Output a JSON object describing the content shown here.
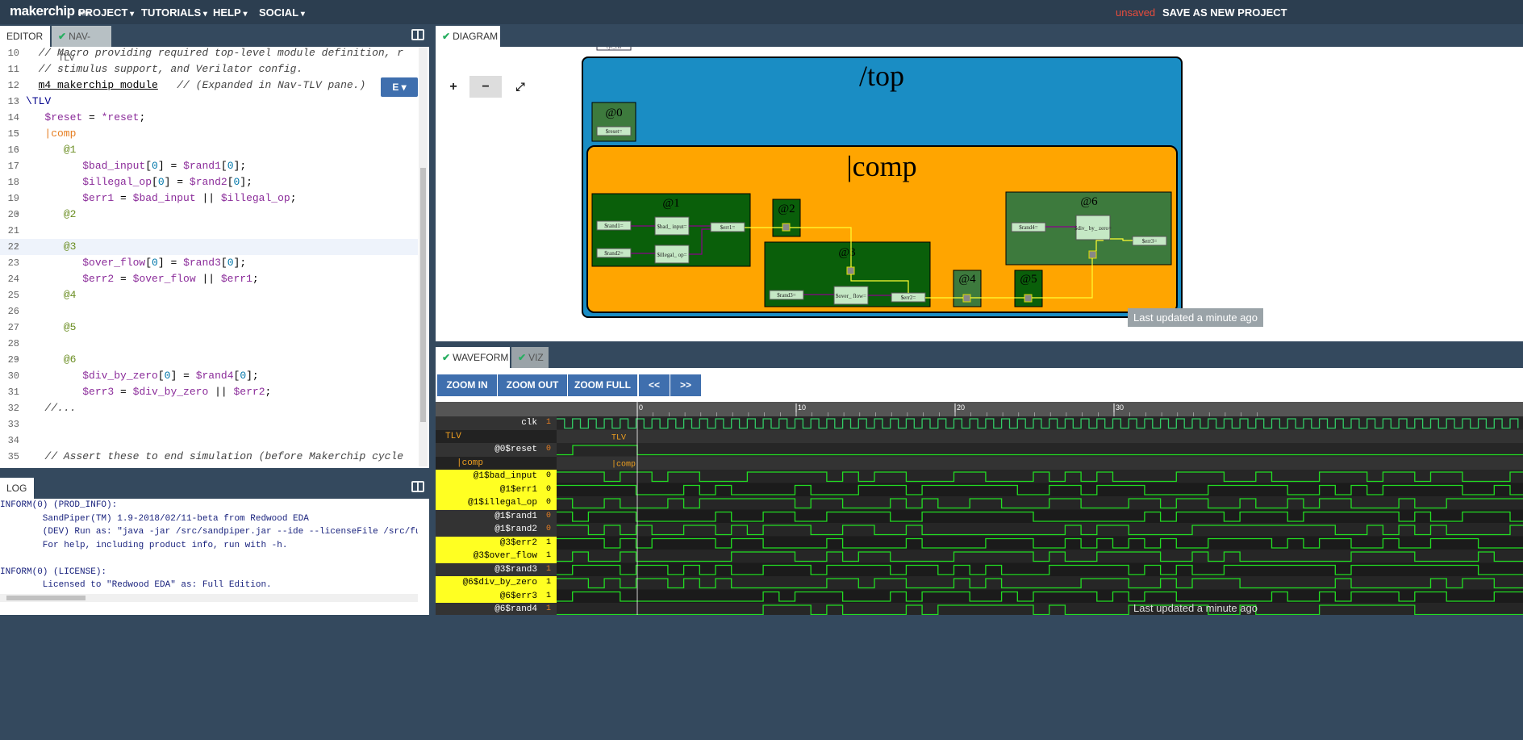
{
  "topbar": {
    "logo": "makerchip",
    "beta": "beta",
    "menus": [
      "PROJECT",
      "TUTORIALS",
      "HELP",
      "SOCIAL"
    ],
    "unsaved": "unsaved",
    "save": "SAVE AS NEW PROJECT"
  },
  "editor": {
    "tabs": [
      "EDITOR",
      "NAV-TLV"
    ],
    "e_button": "E ▾",
    "lines": [
      {
        "n": "10",
        "fold": "",
        "html": "<span class='cm'>  // Macro providing required top-level module definition, r</span>"
      },
      {
        "n": "11",
        "fold": "",
        "html": "<span class='cm'>  // stimulus support, and Verilator config.</span>"
      },
      {
        "n": "12",
        "fold": "",
        "html": "  <u>m4_makerchip_module</u>   <span class='cm'>// (Expanded in Nav-TLV pane.)</span>"
      },
      {
        "n": "13",
        "fold": "▾",
        "html": "<span class='kw'>\\TLV</span>"
      },
      {
        "n": "14",
        "fold": "",
        "html": "   <span class='var'>$reset</span> = <span class='var'>*reset</span>;"
      },
      {
        "n": "15",
        "fold": "▾",
        "html": "   <span class='pipe'>|comp</span>"
      },
      {
        "n": "16",
        "fold": "▾",
        "html": "      <span class='stg'>@1</span>"
      },
      {
        "n": "17",
        "fold": "",
        "html": "         <span class='var'>$bad_input</span>[<span class='num'>0</span>] = <span class='var'>$rand1</span>[<span class='num'>0</span>];"
      },
      {
        "n": "18",
        "fold": "",
        "html": "         <span class='var'>$illegal_op</span>[<span class='num'>0</span>] = <span class='var'>$rand2</span>[<span class='num'>0</span>];"
      },
      {
        "n": "19",
        "fold": "",
        "html": "         <span class='var'>$err1</span> = <span class='var'>$bad_input</span> || <span class='var'>$illegal_op</span>;"
      },
      {
        "n": "20",
        "fold": "▾",
        "html": "      <span class='stg'>@2</span>"
      },
      {
        "n": "21",
        "fold": "",
        "html": ""
      },
      {
        "n": "22",
        "fold": "▾",
        "html": "      <span class='stg'>@3</span>"
      },
      {
        "n": "23",
        "fold": "",
        "html": "         <span class='var'>$over_flow</span>[<span class='num'>0</span>] = <span class='var'>$rand3</span>[<span class='num'>0</span>];"
      },
      {
        "n": "24",
        "fold": "",
        "html": "         <span class='var'>$err2</span> = <span class='var'>$over_flow</span> || <span class='var'>$err1</span>;"
      },
      {
        "n": "25",
        "fold": "",
        "html": "      <span class='stg'>@4</span>"
      },
      {
        "n": "26",
        "fold": "",
        "html": ""
      },
      {
        "n": "27",
        "fold": "",
        "html": "      <span class='stg'>@5</span>"
      },
      {
        "n": "28",
        "fold": "",
        "html": ""
      },
      {
        "n": "29",
        "fold": "▾",
        "html": "      <span class='stg'>@6</span>"
      },
      {
        "n": "30",
        "fold": "",
        "html": "         <span class='var'>$div_by_zero</span>[<span class='num'>0</span>] = <span class='var'>$rand4</span>[<span class='num'>0</span>];"
      },
      {
        "n": "31",
        "fold": "",
        "html": "         <span class='var'>$err3</span> = <span class='var'>$div_by_zero</span> || <span class='var'>$err2</span>;"
      },
      {
        "n": "32",
        "fold": "",
        "html": "   <span class='cm'>//...</span>"
      },
      {
        "n": "33",
        "fold": "",
        "html": ""
      },
      {
        "n": "34",
        "fold": "",
        "html": ""
      },
      {
        "n": "35",
        "fold": "",
        "html": "<span class='cm'>   // Assert these to end simulation (before Makerchip cycle</span>"
      }
    ]
  },
  "log": {
    "tab": "LOG",
    "text": "INFORM(0) (PROD_INFO):\n        SandPiper(TM) 1.9-2018/02/11-beta from Redwood EDA\n        (DEV) Run as: \"java -jar /src/sandpiper.jar --ide --licenseFile /src/full_li\n        For help, including product info, run with -h.\n\nINFORM(0) (LICENSE):\n        Licensed to \"Redwood EDA\" as: Full Edition."
  },
  "diagram": {
    "tab": "DIAGRAM",
    "zoom_in": "+",
    "zoom_out": "−",
    "fullscreen": "⤢",
    "top": "/top",
    "comp": "|comp",
    "stages": [
      "@0",
      "@1",
      "@2",
      "@3",
      "@4",
      "@5",
      "@6"
    ],
    "nodes": {
      "reset": "$reset=",
      "rand1": "$rand1=",
      "rand2": "$rand2=",
      "bad_input": "$bad_ input=",
      "illegal_op": "$illegal_ op=",
      "err1": "$err1=",
      "rand3": "$rand3=",
      "over_flow": "$over_ flow=",
      "err2": "$err2=",
      "rand4": "$rand4=",
      "div_by_zero": "$div_ by_ zero=",
      "err3": "$err3=",
      "cyc_cnt": "cyc_cnt"
    },
    "last_updated": "Last updated a minute ago"
  },
  "waveform": {
    "tabs": [
      "WAVEFORM",
      "VIZ"
    ],
    "buttons": [
      "ZOOM IN",
      "ZOOM OUT",
      "ZOOM FULL",
      "<<",
      ">>"
    ],
    "ticks": [
      "0",
      "10",
      "20",
      "30"
    ],
    "signals": [
      {
        "name": "clk",
        "val": "1",
        "kind": "clk"
      },
      {
        "name": "TLV",
        "val": "",
        "kind": "scope"
      },
      {
        "name": "@0$reset",
        "val": "0",
        "kind": "dark"
      },
      {
        "name": "|comp",
        "val": "",
        "kind": "scope"
      },
      {
        "name": "@1$bad_input",
        "val": "0",
        "kind": "yellow"
      },
      {
        "name": "@1$err1",
        "val": "0",
        "kind": "yellow"
      },
      {
        "name": "@1$illegal_op",
        "val": "0",
        "kind": "yellow"
      },
      {
        "name": "@1$rand1",
        "val": "0",
        "kind": "dark"
      },
      {
        "name": "@1$rand2",
        "val": "0",
        "kind": "dark"
      },
      {
        "name": "@3$err2",
        "val": "1",
        "kind": "yellow"
      },
      {
        "name": "@3$over_flow",
        "val": "1",
        "kind": "yellow"
      },
      {
        "name": "@3$rand3",
        "val": "1",
        "kind": "dark"
      },
      {
        "name": "@6$div_by_zero",
        "val": "1",
        "kind": "yellow"
      },
      {
        "name": "@6$err3",
        "val": "1",
        "kind": "yellow"
      },
      {
        "name": "@6$rand4",
        "val": "1",
        "kind": "dark"
      }
    ],
    "last_updated": "Last updated a minute ago"
  }
}
